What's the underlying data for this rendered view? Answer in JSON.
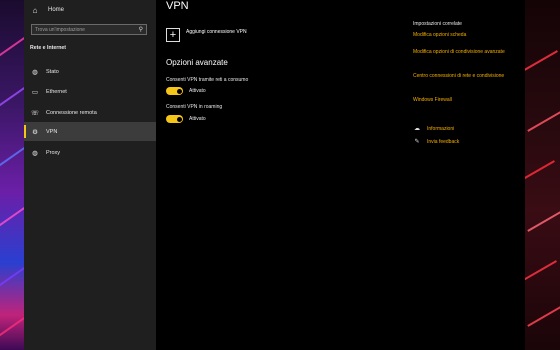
{
  "sidebar": {
    "home_label": "Home",
    "search_placeholder": "Trova un'impostazione",
    "section_title": "Rete e Internet",
    "items": [
      {
        "label": "Stato",
        "icon": "globe-icon"
      },
      {
        "label": "Ethernet",
        "icon": "ethernet-icon"
      },
      {
        "label": "Connessione remota",
        "icon": "dialup-icon"
      },
      {
        "label": "VPN",
        "icon": "vpn-icon",
        "selected": true
      },
      {
        "label": "Proxy",
        "icon": "globe-icon"
      }
    ]
  },
  "main": {
    "title": "VPN",
    "add_vpn_label": "Aggiungi connessione VPN",
    "advanced_title": "Opzioni avanzate",
    "toggles": [
      {
        "label": "Consenti VPN tramite reti a consumo",
        "state": "Attivato",
        "on": true
      },
      {
        "label": "Consenti VPN in roaming",
        "state": "Attivato",
        "on": true
      }
    ]
  },
  "related": {
    "title": "Impostazioni correlate",
    "links": [
      "Modifica opzioni scheda",
      "Modifica opzioni di condivisione avanzate",
      "Centro connessioni di rete e condivisione",
      "Windows Firewall"
    ],
    "help": [
      {
        "label": "Informazioni",
        "icon": "help-icon"
      },
      {
        "label": "Invia feedback",
        "icon": "feedback-icon"
      }
    ]
  },
  "colors": {
    "accent": "#f5c518",
    "link": "#f5b000",
    "sidebar_bg": "#1f1f1f",
    "main_bg": "#000000"
  }
}
